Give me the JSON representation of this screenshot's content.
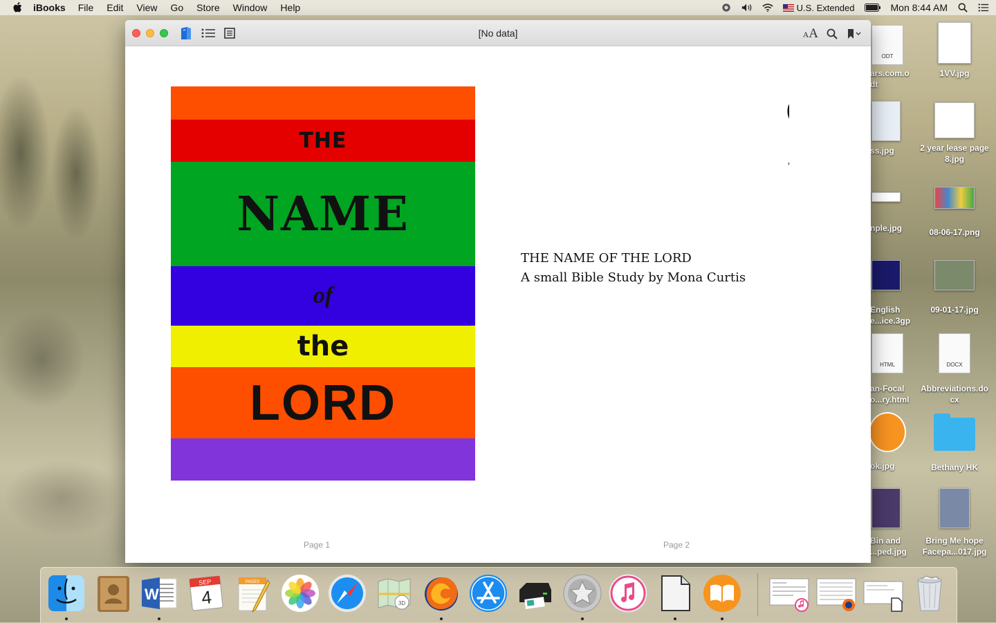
{
  "menubar": {
    "app_name": "iBooks",
    "menus": [
      "File",
      "Edit",
      "View",
      "Go",
      "Store",
      "Window",
      "Help"
    ],
    "input_source": "U.S. Extended",
    "clock": "Mon 8:44 AM"
  },
  "window": {
    "title": "[No data]"
  },
  "book": {
    "cover": {
      "line1": "THE",
      "line2": "NAME",
      "line3": "of",
      "line4": "the",
      "line5": "LORD",
      "band_colors": [
        "#fe4e00",
        "#e50000",
        "#00a521",
        "#3300e0",
        "#f0ef00",
        "#fe4e00",
        "#8134d9"
      ]
    },
    "hebrew_text": "יהוה",
    "title": "THE NAME OF THE LORD",
    "subtitle": "A small Bible Study by Mona Curtis",
    "page_left": "Page 1",
    "page_right": "Page 2"
  },
  "desktop_icons": [
    {
      "label": "ars.com.o dt",
      "badge": "ODT"
    },
    {
      "label": "1VV.jpg"
    },
    {
      "label": "ss.jpg"
    },
    {
      "label": "2 year lease page 8.jpg"
    },
    {
      "label": "nple.jpg"
    },
    {
      "label": "08-06-17.png"
    },
    {
      "label": "English e...ice.3gp"
    },
    {
      "label": "09-01-17.jpg"
    },
    {
      "label": "an-Focal o...ry.html",
      "badge": "HTML"
    },
    {
      "label": "Abbreviations.do cx",
      "badge": "DOCX"
    },
    {
      "label": "ok.jpg"
    },
    {
      "label": "Bethany HK"
    },
    {
      "label": "Bin and ...ped.jpg"
    },
    {
      "label": "Bring Me hope Facepa...017.jpg"
    }
  ],
  "dock": {
    "calendar_month": "SEP",
    "calendar_day": "4",
    "pages_badge": "PAGES"
  }
}
